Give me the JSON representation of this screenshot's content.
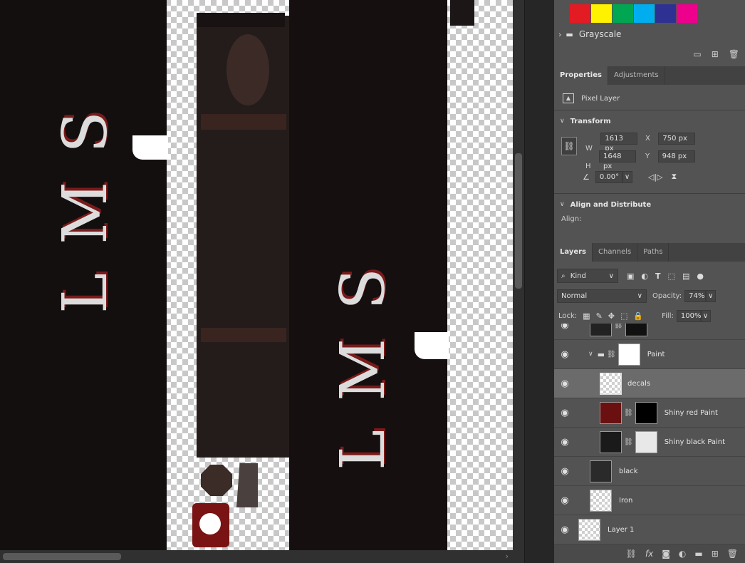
{
  "canvas": {
    "text_left": "LMS",
    "text_right": "LMS"
  },
  "swatches": {
    "colors": [
      "#e31b23",
      "#fff200",
      "#00a651",
      "#00aeef",
      "#2e3192",
      "#ec008c"
    ],
    "group_name": "Grayscale"
  },
  "properties": {
    "tabs": [
      "Properties",
      "Adjustments"
    ],
    "layer_type": "Pixel Layer",
    "transform_title": "Transform",
    "w_label": "W",
    "w_value": "1613 px",
    "h_label": "H",
    "h_value": "1648 px",
    "x_label": "X",
    "x_value": "750 px",
    "y_label": "Y",
    "y_value": "948 px",
    "angle_value": "0.00°",
    "align_title": "Align and Distribute",
    "align_label": "Align:"
  },
  "layers_panel": {
    "tabs": [
      "Layers",
      "Channels",
      "Paths"
    ],
    "filter_kind": "Kind",
    "blend_mode": "Normal",
    "opacity_label": "Opacity:",
    "opacity_value": "74%",
    "lock_label": "Lock:",
    "fill_label": "Fill:",
    "fill_value": "100%",
    "layers": [
      {
        "name": "Paint",
        "type": "group"
      },
      {
        "name": "decals",
        "selected": true
      },
      {
        "name": "Shiny red Paint"
      },
      {
        "name": "Shiny black Paint"
      },
      {
        "name": "black"
      },
      {
        "name": "Iron"
      },
      {
        "name": "Layer 1"
      }
    ]
  }
}
